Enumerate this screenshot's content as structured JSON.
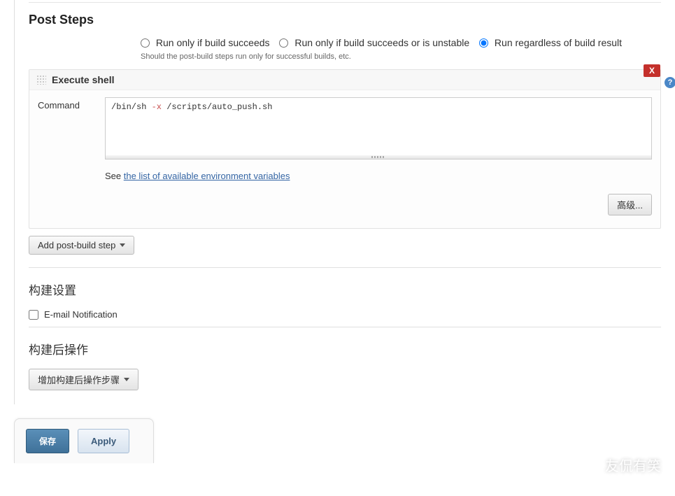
{
  "post_steps": {
    "title": "Post Steps",
    "radio_succeeds": "Run only if build succeeds",
    "radio_unstable": "Run only if build succeeds or is unstable",
    "radio_regardless": "Run regardless of build result",
    "selected": "regardless",
    "hint": "Should the post-build steps run only for successful builds, etc.",
    "shell_block": {
      "title": "Execute shell",
      "command_label": "Command",
      "command_value": "/bin/sh -x /scripts/auto_push.sh",
      "see_prefix": "See ",
      "see_link": "the list of available environment variables",
      "advanced_label": "高级...",
      "delete_label": "X"
    },
    "add_step_label": "Add post-build step"
  },
  "build_settings": {
    "title": "构建设置",
    "email_label": "E-mail Notification",
    "email_checked": false
  },
  "post_build_actions": {
    "title": "构建后操作",
    "add_label": "增加构建后操作步骤"
  },
  "footer": {
    "save": "保存",
    "apply": "Apply"
  },
  "watermark": "友侃有笑"
}
